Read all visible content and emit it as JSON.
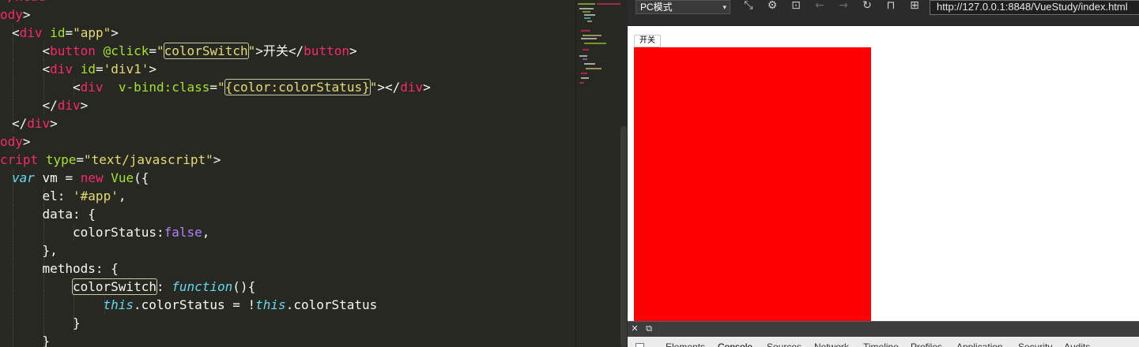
{
  "editor": {
    "lines": [
      {
        "indent": 0,
        "tokens": [
          {
            "t": "</",
            "c": "tag"
          },
          {
            "t": "head",
            "c": "tag"
          },
          {
            "t": ">",
            "c": "txt"
          }
        ]
      },
      {
        "indent": 0,
        "tokens": [
          {
            "t": "ody",
            "c": "tag"
          },
          {
            "t": ">",
            "c": "txt"
          }
        ]
      },
      {
        "indent": 1,
        "tokens": [
          {
            "t": "<",
            "c": "txt"
          },
          {
            "t": "div",
            "c": "tag"
          },
          {
            "t": " ",
            "c": "txt"
          },
          {
            "t": "id",
            "c": "attr"
          },
          {
            "t": "=",
            "c": "txt"
          },
          {
            "t": "\"app\"",
            "c": "str"
          },
          {
            "t": ">",
            "c": "txt"
          }
        ]
      },
      {
        "indent": 2,
        "tokens": [
          {
            "t": "<",
            "c": "txt"
          },
          {
            "t": "button",
            "c": "tag"
          },
          {
            "t": " ",
            "c": "txt"
          },
          {
            "t": "@click",
            "c": "attr"
          },
          {
            "t": "=",
            "c": "txt"
          },
          {
            "t": "\"",
            "c": "str"
          },
          {
            "t": "colorSwitch",
            "c": "str",
            "box": true
          },
          {
            "t": "\"",
            "c": "str"
          },
          {
            "t": ">开关</",
            "c": "txt"
          },
          {
            "t": "button",
            "c": "tag"
          },
          {
            "t": ">",
            "c": "txt"
          }
        ]
      },
      {
        "indent": 2,
        "tokens": [
          {
            "t": "<",
            "c": "txt"
          },
          {
            "t": "div",
            "c": "tag"
          },
          {
            "t": " ",
            "c": "txt"
          },
          {
            "t": "id",
            "c": "attr"
          },
          {
            "t": "=",
            "c": "txt"
          },
          {
            "t": "'div1'",
            "c": "str"
          },
          {
            "t": ">",
            "c": "txt"
          }
        ]
      },
      {
        "indent": 3,
        "tokens": [
          {
            "t": "<",
            "c": "txt"
          },
          {
            "t": "div",
            "c": "tag"
          },
          {
            "t": "  ",
            "c": "txt"
          },
          {
            "t": "v-bind:class",
            "c": "attr"
          },
          {
            "t": "=",
            "c": "txt"
          },
          {
            "t": "\"",
            "c": "str"
          },
          {
            "t": "{color:colorStatus}",
            "c": "str",
            "box": true
          },
          {
            "t": "\"",
            "c": "str"
          },
          {
            "t": "></",
            "c": "txt"
          },
          {
            "t": "div",
            "c": "tag"
          },
          {
            "t": ">",
            "c": "txt"
          }
        ]
      },
      {
        "indent": 2,
        "tokens": [
          {
            "t": "</",
            "c": "txt"
          },
          {
            "t": "div",
            "c": "tag"
          },
          {
            "t": ">",
            "c": "txt"
          }
        ]
      },
      {
        "indent": 1,
        "tokens": [
          {
            "t": "</",
            "c": "txt"
          },
          {
            "t": "div",
            "c": "tag"
          },
          {
            "t": ">",
            "c": "txt"
          }
        ]
      },
      {
        "indent": 0,
        "tokens": [
          {
            "t": "ody",
            "c": "tag"
          },
          {
            "t": ">",
            "c": "txt"
          }
        ]
      },
      {
        "indent": 0,
        "tokens": [
          {
            "t": "cript",
            "c": "tag"
          },
          {
            "t": " ",
            "c": "txt"
          },
          {
            "t": "type",
            "c": "attr"
          },
          {
            "t": "=",
            "c": "txt"
          },
          {
            "t": "\"text/javascript\"",
            "c": "str"
          },
          {
            "t": ">",
            "c": "txt"
          }
        ]
      },
      {
        "indent": 1,
        "tokens": [
          {
            "t": "var",
            "c": "kw"
          },
          {
            "t": " vm = ",
            "c": "txt"
          },
          {
            "t": "new",
            "c": "op"
          },
          {
            "t": " ",
            "c": "txt"
          },
          {
            "t": "Vue",
            "c": "fn"
          },
          {
            "t": "({",
            "c": "txt"
          }
        ]
      },
      {
        "indent": 2,
        "tokens": [
          {
            "t": "el: ",
            "c": "txt"
          },
          {
            "t": "'#app'",
            "c": "str"
          },
          {
            "t": ",",
            "c": "txt"
          }
        ]
      },
      {
        "indent": 2,
        "tokens": [
          {
            "t": "data: {",
            "c": "txt"
          }
        ]
      },
      {
        "indent": 3,
        "tokens": [
          {
            "t": "colorStatus:",
            "c": "txt"
          },
          {
            "t": "false",
            "c": "cons"
          },
          {
            "t": ",",
            "c": "txt"
          }
        ]
      },
      {
        "indent": 2,
        "tokens": [
          {
            "t": "},",
            "c": "txt"
          }
        ]
      },
      {
        "indent": 2,
        "tokens": [
          {
            "t": "methods: {",
            "c": "txt"
          }
        ]
      },
      {
        "indent": 3,
        "tokens": [
          {
            "t": "colorSwitch",
            "c": "txt",
            "box": true
          },
          {
            "t": ": ",
            "c": "txt"
          },
          {
            "t": "function",
            "c": "kw"
          },
          {
            "t": "(){",
            "c": "txt"
          }
        ]
      },
      {
        "indent": 4,
        "tokens": [
          {
            "t": "this",
            "c": "kw"
          },
          {
            "t": ".colorStatus = !",
            "c": "txt"
          },
          {
            "t": "this",
            "c": "kw"
          },
          {
            "t": ".colorStatus",
            "c": "txt"
          }
        ]
      },
      {
        "indent": 3,
        "tokens": [
          {
            "t": "}",
            "c": "txt"
          }
        ]
      },
      {
        "indent": 2,
        "tokens": [
          {
            "t": "}",
            "c": "txt"
          }
        ]
      }
    ]
  },
  "browser": {
    "mode_label": "PC模式",
    "url": "http://127.0.0.1:8848/VueStudy/index.html",
    "toolbar_icons": [
      "resize-icon",
      "settings-icon",
      "console-icon",
      "back-icon",
      "forward-icon",
      "reload-icon",
      "lock-icon",
      "qrcode-icon"
    ],
    "page": {
      "button_label": "开关",
      "box_color": "#ff0000"
    },
    "devtools": {
      "tabs": [
        "Elements",
        "Console",
        "Sources",
        "Network",
        "Timeline",
        "Profiles",
        "Application",
        "Security",
        "Audits"
      ],
      "active_tab": "Console"
    }
  },
  "theme": {
    "editor_bg": "#272822",
    "tag": "#f92672",
    "attr": "#a6e22e",
    "string": "#e6db74",
    "keyword": "#66d9ef",
    "constant": "#ae81ff"
  }
}
